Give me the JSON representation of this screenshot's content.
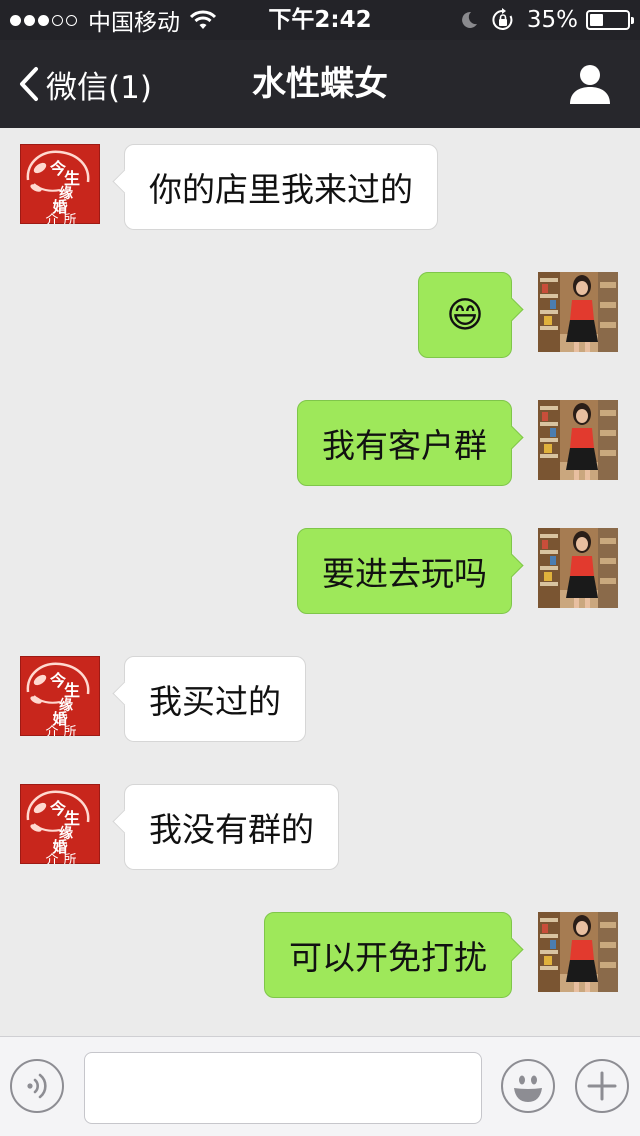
{
  "status_bar": {
    "signal_dots": [
      "full",
      "full",
      "full",
      "empty",
      "empty"
    ],
    "carrier": "中国移动",
    "wifi_icon": "wifi-icon",
    "time": "下午2:42",
    "moon_icon": "do-not-disturb-moon-icon",
    "rotation_lock_icon": "rotation-lock-icon",
    "battery_percent": "35%",
    "battery_level": 0.35
  },
  "nav": {
    "back_icon": "chevron-left-icon",
    "back_label": "微信(1)",
    "title": "水性蝶女",
    "profile_icon": "person-icon"
  },
  "messages": [
    {
      "side": "left",
      "text": "你的店里我来过的"
    },
    {
      "side": "right",
      "emoji": "😄"
    },
    {
      "side": "right",
      "text": "我有客户群"
    },
    {
      "side": "right",
      "text": "要进去玩吗"
    },
    {
      "side": "left",
      "text": "我买过的"
    },
    {
      "side": "left",
      "text": "我没有群的"
    },
    {
      "side": "right",
      "text": "可以开免打扰"
    }
  ],
  "contact_avatar": {
    "logo_text": "今生缘婚介所",
    "background": "#c8261c"
  },
  "input_bar": {
    "voice_icon": "voice-icon",
    "input_value": "",
    "emoji_icon": "emoji-icon",
    "add_icon": "plus-icon"
  },
  "colors": {
    "outgoing_bubble": "#9ee85a",
    "incoming_bubble": "#ffffff",
    "nav_background": "#27272c",
    "chat_background": "#ebebeb"
  }
}
